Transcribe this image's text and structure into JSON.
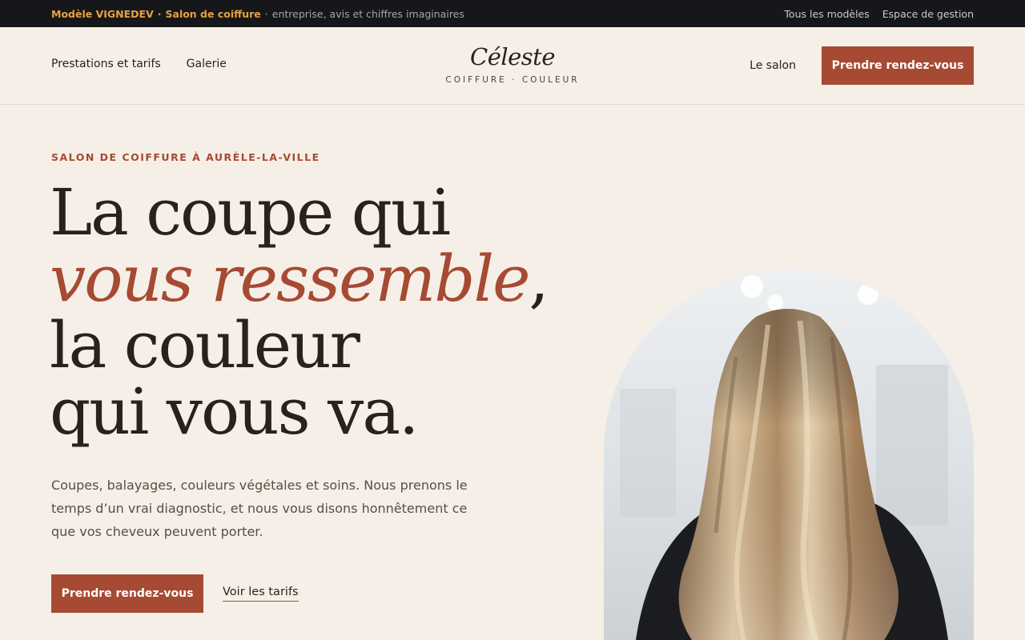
{
  "topbar": {
    "brand": "Modèle VIGNEDEV",
    "separator": "·",
    "category": "Salon de coiffure",
    "tagline": "entreprise, avis et chiffres imaginaires",
    "links": [
      "Tous les modèles",
      "Espace de gestion"
    ]
  },
  "header": {
    "nav_left": [
      "Prestations et tarifs",
      "Galerie"
    ],
    "logo_name": "Céleste",
    "logo_tag": "COIFFURE · COULEUR",
    "nav_right": "Le salon",
    "cta": "Prendre rendez-vous"
  },
  "hero": {
    "eyebrow": "SALON DE COIFFURE À AURÈLE-LA-VILLE",
    "line1": "La coupe qui",
    "line2_accent": "vous ressemble",
    "line2_end": ",",
    "line3": "la couleur",
    "line4": "qui vous va.",
    "lede": "Coupes, balayages, couleurs végétales et soins. Nous prenons le temps d’un vrai diagnostic, et nous vous disons honnêtement ce que vos cheveux peuvent porter.",
    "cta": "Prendre rendez-vous",
    "secondary": "Voir les tarifs"
  },
  "colors": {
    "accent": "#a64a33",
    "background": "#f6efe7",
    "topbar": "#16171a",
    "topbar_brand": "#e8a13c"
  }
}
